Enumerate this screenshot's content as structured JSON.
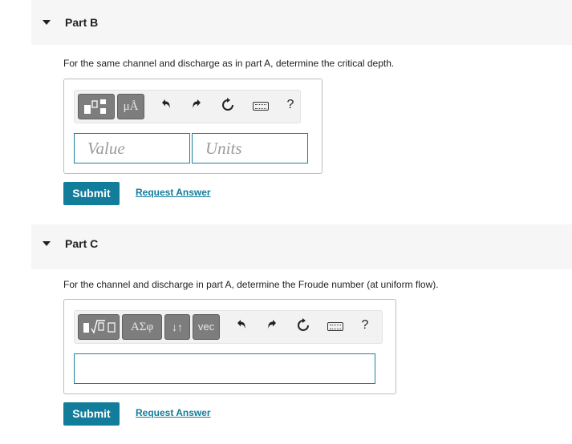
{
  "part_b": {
    "title": "Part B",
    "question": "For the same channel and discharge as in part A, determine the critical depth.",
    "toolbar": {
      "templates_icon": "templates-icon",
      "units_label": "μÅ",
      "undo_icon": "undo-icon",
      "redo_icon": "redo-icon",
      "reset_icon": "reset-icon",
      "keyboard_icon": "keyboard-icon",
      "help_label": "?"
    },
    "value_placeholder": "Value",
    "units_placeholder": "Units",
    "submit_label": "Submit",
    "request_answer_label": "Request Answer"
  },
  "part_c": {
    "title": "Part C",
    "question": "For the channel and discharge in part A, determine the Froude number (at uniform flow).",
    "toolbar": {
      "templates_icon": "templates-sqrt-icon",
      "greek_label": "ΑΣφ",
      "arrows_label": "↓↑",
      "vec_label": "vec",
      "undo_icon": "undo-icon",
      "redo_icon": "redo-icon",
      "reset_icon": "reset-icon",
      "keyboard_icon": "keyboard-icon",
      "help_label": "?"
    },
    "answer_value": "",
    "submit_label": "Submit",
    "request_answer_label": "Request Answer"
  },
  "colors": {
    "accent": "#127c9b",
    "input_border": "#1c7fa3",
    "header_bg": "#f6f6f6",
    "button_gray": "#7d7d7d"
  }
}
